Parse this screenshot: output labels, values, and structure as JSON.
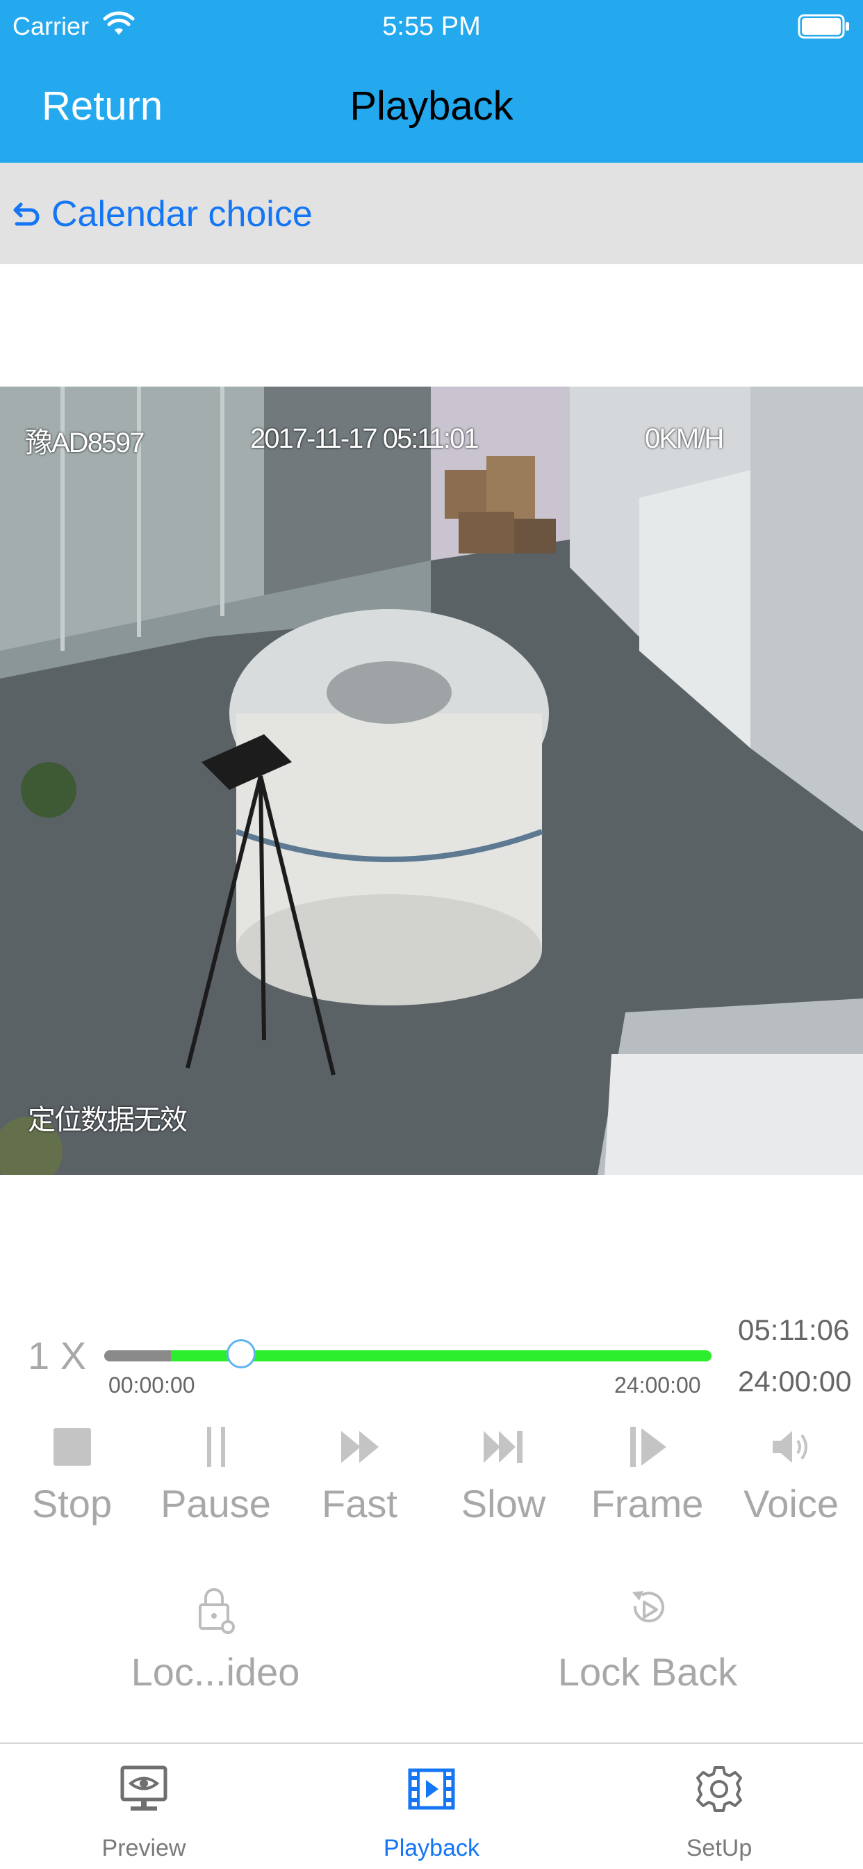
{
  "status_bar": {
    "carrier": "Carrier",
    "time": "5:55 PM"
  },
  "nav": {
    "back_label": "Return",
    "title": "Playback"
  },
  "calendar": {
    "label": "Calendar choice"
  },
  "video": {
    "plate": "豫AD8597",
    "datetime": "2017-11-17 05:11:01",
    "speed": "0KM/H",
    "gps_status": "定位数据无效"
  },
  "playback": {
    "speed_label": "1 X",
    "range_start": "00:00:00",
    "range_end": "24:00:00",
    "current_time": "05:11:06",
    "total_time": "24:00:00",
    "progress_fraction": 0.11
  },
  "controls": [
    {
      "label": "Stop",
      "icon": "stop-icon"
    },
    {
      "label": "Pause",
      "icon": "pause-icon"
    },
    {
      "label": "Fast",
      "icon": "fast-forward-icon"
    },
    {
      "label": "Slow",
      "icon": "slow-icon"
    },
    {
      "label": "Frame",
      "icon": "frame-step-icon"
    },
    {
      "label": "Voice",
      "icon": "speaker-icon"
    }
  ],
  "extras": [
    {
      "label": "Loc...ideo",
      "icon": "lock-video-icon"
    },
    {
      "label": "Lock Back",
      "icon": "lock-back-icon"
    }
  ],
  "tabs": [
    {
      "label": "Preview",
      "icon": "monitor-eye-icon",
      "active": false
    },
    {
      "label": "Playback",
      "icon": "film-play-icon",
      "active": true
    },
    {
      "label": "SetUp",
      "icon": "gear-icon",
      "active": false
    }
  ],
  "colors": {
    "header_bg": "#24a8ee",
    "accent_blue": "#1476f4",
    "progress_green": "#2cee2c",
    "control_gray": "#a8a8a8"
  }
}
